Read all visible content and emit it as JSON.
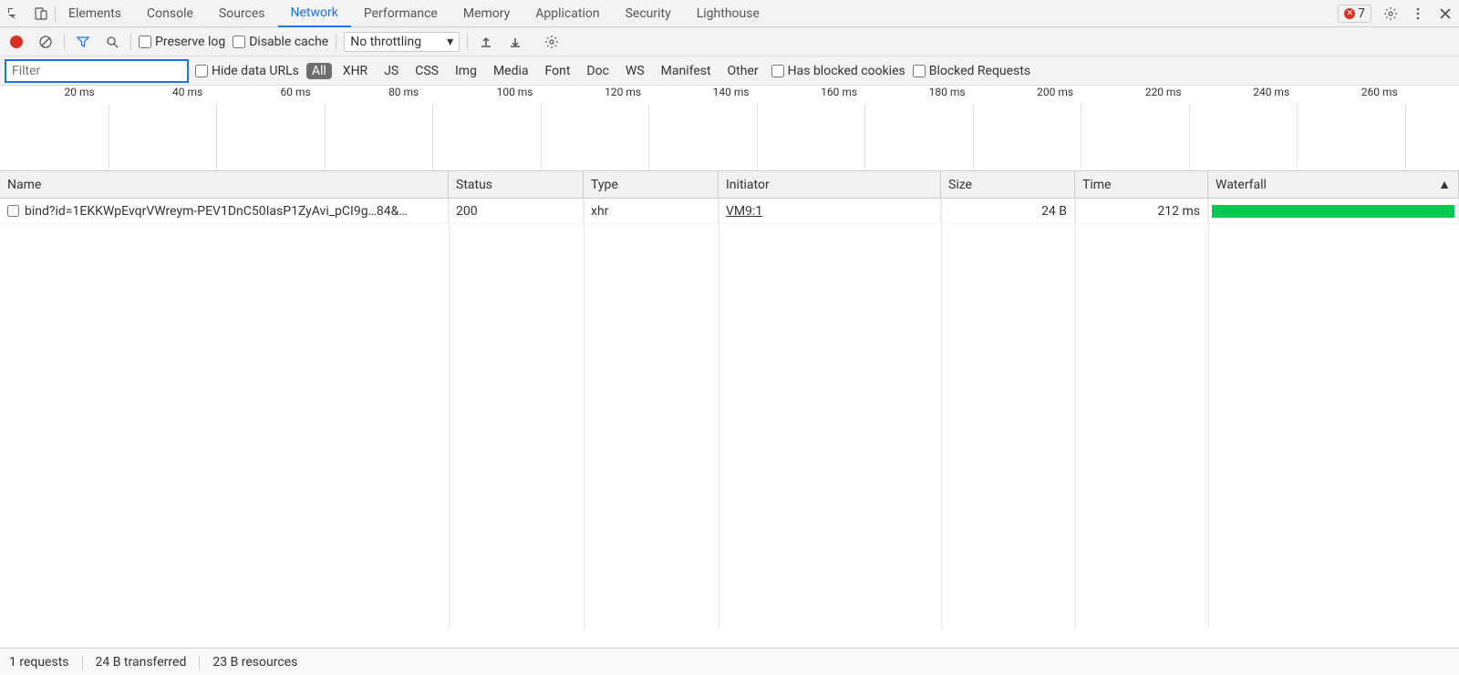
{
  "topTabs": {
    "items": [
      "Elements",
      "Console",
      "Sources",
      "Network",
      "Performance",
      "Memory",
      "Application",
      "Security",
      "Lighthouse"
    ],
    "active": "Network",
    "errorCount": "7"
  },
  "toolbar": {
    "preserveLog": "Preserve log",
    "disableCache": "Disable cache",
    "throttling": "No throttling"
  },
  "filterRow": {
    "placeholder": "Filter",
    "hideDataUrls": "Hide data URLs",
    "chips": [
      "All",
      "XHR",
      "JS",
      "CSS",
      "Img",
      "Media",
      "Font",
      "Doc",
      "WS",
      "Manifest",
      "Other"
    ],
    "activeChip": "All",
    "hasBlockedCookies": "Has blocked cookies",
    "blockedRequests": "Blocked Requests"
  },
  "timeline": {
    "ticks": [
      "20 ms",
      "40 ms",
      "60 ms",
      "80 ms",
      "100 ms",
      "120 ms",
      "140 ms",
      "160 ms",
      "180 ms",
      "200 ms",
      "220 ms",
      "240 ms",
      "260 ms"
    ]
  },
  "table": {
    "headers": {
      "name": "Name",
      "status": "Status",
      "type": "Type",
      "initiator": "Initiator",
      "size": "Size",
      "time": "Time",
      "waterfall": "Waterfall"
    },
    "rows": [
      {
        "name": "bind?id=1EKKWpEvqrVWreym-PEV1DnC50IasP1ZyAvi_pCI9g…84&…",
        "status": "200",
        "type": "xhr",
        "initiator": "VM9:1",
        "size": "24 B",
        "time": "212 ms"
      }
    ]
  },
  "footer": {
    "requests": "1 requests",
    "transferred": "24 B transferred",
    "resources": "23 B resources"
  }
}
